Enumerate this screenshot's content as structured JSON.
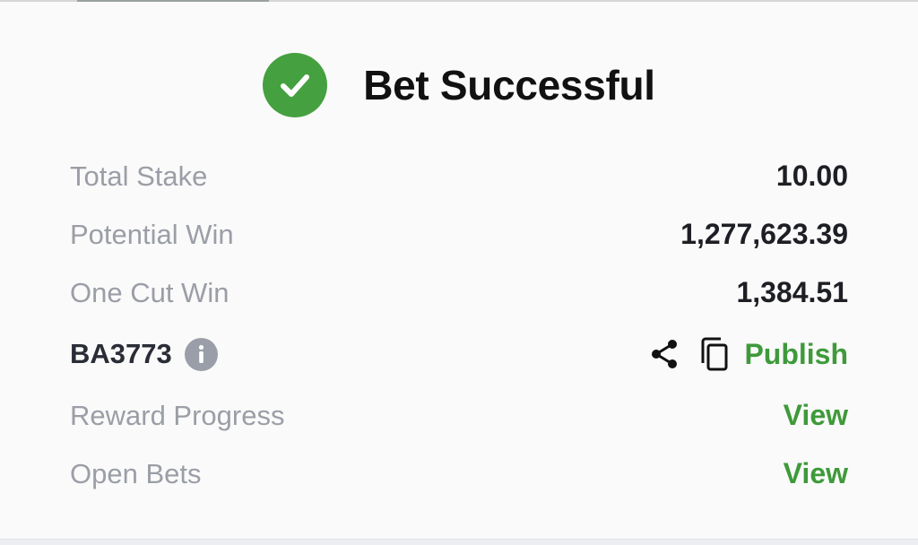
{
  "header": {
    "title": "Bet Successful",
    "icon": "check-circle-icon",
    "accent_color": "#45a03f"
  },
  "summary": {
    "total_stake": {
      "label": "Total Stake",
      "value": "10.00"
    },
    "potential_win": {
      "label": "Potential Win",
      "value": "1,277,623.39"
    },
    "one_cut_win": {
      "label": "One Cut Win",
      "value": "1,384.51"
    }
  },
  "booking": {
    "code": "BA3773",
    "info_icon": "info-icon",
    "share_icon": "share-icon",
    "copy_icon": "copy-icon",
    "publish_label": "Publish"
  },
  "links": {
    "reward_progress": {
      "label": "Reward Progress",
      "action": "View"
    },
    "open_bets": {
      "label": "Open Bets",
      "action": "View"
    }
  },
  "colors": {
    "link_green": "#3e9a3a",
    "label_gray": "#9b9ea6",
    "value_dark": "#1e1f24"
  }
}
